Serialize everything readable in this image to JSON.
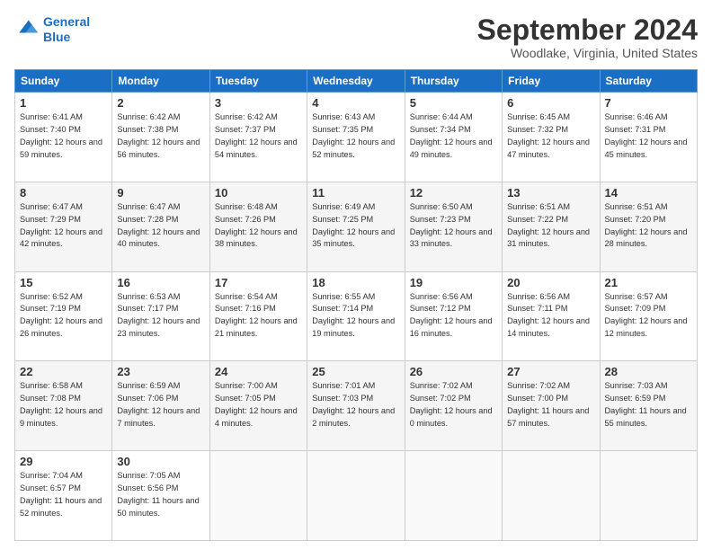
{
  "logo": {
    "line1": "General",
    "line2": "Blue"
  },
  "title": "September 2024",
  "location": "Woodlake, Virginia, United States",
  "days_of_week": [
    "Sunday",
    "Monday",
    "Tuesday",
    "Wednesday",
    "Thursday",
    "Friday",
    "Saturday"
  ],
  "weeks": [
    [
      {
        "day": "1",
        "sunrise": "6:41 AM",
        "sunset": "7:40 PM",
        "daylight": "12 hours and 59 minutes."
      },
      {
        "day": "2",
        "sunrise": "6:42 AM",
        "sunset": "7:38 PM",
        "daylight": "12 hours and 56 minutes."
      },
      {
        "day": "3",
        "sunrise": "6:42 AM",
        "sunset": "7:37 PM",
        "daylight": "12 hours and 54 minutes."
      },
      {
        "day": "4",
        "sunrise": "6:43 AM",
        "sunset": "7:35 PM",
        "daylight": "12 hours and 52 minutes."
      },
      {
        "day": "5",
        "sunrise": "6:44 AM",
        "sunset": "7:34 PM",
        "daylight": "12 hours and 49 minutes."
      },
      {
        "day": "6",
        "sunrise": "6:45 AM",
        "sunset": "7:32 PM",
        "daylight": "12 hours and 47 minutes."
      },
      {
        "day": "7",
        "sunrise": "6:46 AM",
        "sunset": "7:31 PM",
        "daylight": "12 hours and 45 minutes."
      }
    ],
    [
      {
        "day": "8",
        "sunrise": "6:47 AM",
        "sunset": "7:29 PM",
        "daylight": "12 hours and 42 minutes."
      },
      {
        "day": "9",
        "sunrise": "6:47 AM",
        "sunset": "7:28 PM",
        "daylight": "12 hours and 40 minutes."
      },
      {
        "day": "10",
        "sunrise": "6:48 AM",
        "sunset": "7:26 PM",
        "daylight": "12 hours and 38 minutes."
      },
      {
        "day": "11",
        "sunrise": "6:49 AM",
        "sunset": "7:25 PM",
        "daylight": "12 hours and 35 minutes."
      },
      {
        "day": "12",
        "sunrise": "6:50 AM",
        "sunset": "7:23 PM",
        "daylight": "12 hours and 33 minutes."
      },
      {
        "day": "13",
        "sunrise": "6:51 AM",
        "sunset": "7:22 PM",
        "daylight": "12 hours and 31 minutes."
      },
      {
        "day": "14",
        "sunrise": "6:51 AM",
        "sunset": "7:20 PM",
        "daylight": "12 hours and 28 minutes."
      }
    ],
    [
      {
        "day": "15",
        "sunrise": "6:52 AM",
        "sunset": "7:19 PM",
        "daylight": "12 hours and 26 minutes."
      },
      {
        "day": "16",
        "sunrise": "6:53 AM",
        "sunset": "7:17 PM",
        "daylight": "12 hours and 23 minutes."
      },
      {
        "day": "17",
        "sunrise": "6:54 AM",
        "sunset": "7:16 PM",
        "daylight": "12 hours and 21 minutes."
      },
      {
        "day": "18",
        "sunrise": "6:55 AM",
        "sunset": "7:14 PM",
        "daylight": "12 hours and 19 minutes."
      },
      {
        "day": "19",
        "sunrise": "6:56 AM",
        "sunset": "7:12 PM",
        "daylight": "12 hours and 16 minutes."
      },
      {
        "day": "20",
        "sunrise": "6:56 AM",
        "sunset": "7:11 PM",
        "daylight": "12 hours and 14 minutes."
      },
      {
        "day": "21",
        "sunrise": "6:57 AM",
        "sunset": "7:09 PM",
        "daylight": "12 hours and 12 minutes."
      }
    ],
    [
      {
        "day": "22",
        "sunrise": "6:58 AM",
        "sunset": "7:08 PM",
        "daylight": "12 hours and 9 minutes."
      },
      {
        "day": "23",
        "sunrise": "6:59 AM",
        "sunset": "7:06 PM",
        "daylight": "12 hours and 7 minutes."
      },
      {
        "day": "24",
        "sunrise": "7:00 AM",
        "sunset": "7:05 PM",
        "daylight": "12 hours and 4 minutes."
      },
      {
        "day": "25",
        "sunrise": "7:01 AM",
        "sunset": "7:03 PM",
        "daylight": "12 hours and 2 minutes."
      },
      {
        "day": "26",
        "sunrise": "7:02 AM",
        "sunset": "7:02 PM",
        "daylight": "12 hours and 0 minutes."
      },
      {
        "day": "27",
        "sunrise": "7:02 AM",
        "sunset": "7:00 PM",
        "daylight": "11 hours and 57 minutes."
      },
      {
        "day": "28",
        "sunrise": "7:03 AM",
        "sunset": "6:59 PM",
        "daylight": "11 hours and 55 minutes."
      }
    ],
    [
      {
        "day": "29",
        "sunrise": "7:04 AM",
        "sunset": "6:57 PM",
        "daylight": "11 hours and 52 minutes."
      },
      {
        "day": "30",
        "sunrise": "7:05 AM",
        "sunset": "6:56 PM",
        "daylight": "11 hours and 50 minutes."
      },
      null,
      null,
      null,
      null,
      null
    ]
  ]
}
